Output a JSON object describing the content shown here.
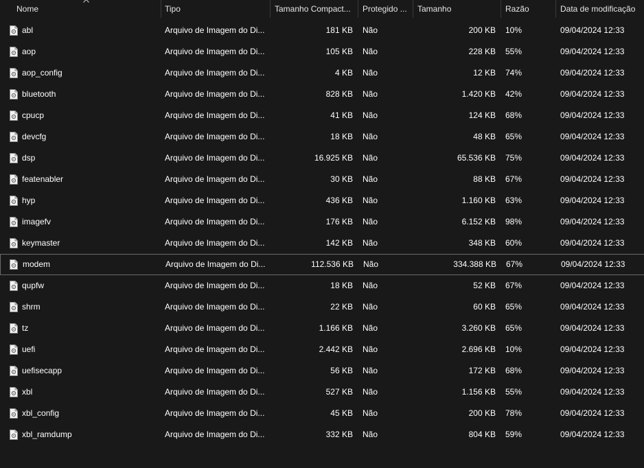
{
  "columns": {
    "name": "Nome",
    "type": "Tipo",
    "compressed_size": "Tamanho Compact...",
    "protected": "Protegido ...",
    "size": "Tamanho",
    "ratio": "Razão",
    "modified": "Data de modificação"
  },
  "icons": {
    "file": "file-image-icon",
    "sort": "sort-ascending-icon"
  },
  "colors": {
    "background": "#191919",
    "text": "#ffffff",
    "selection_border": "#6b6b6b"
  },
  "files": [
    {
      "name": "abl",
      "type": "Arquivo de Imagem do Di...",
      "compressed_size": "181 KB",
      "protected": "Não",
      "size": "200 KB",
      "ratio": "10%",
      "modified": "09/04/2024 12:33"
    },
    {
      "name": "aop",
      "type": "Arquivo de Imagem do Di...",
      "compressed_size": "105 KB",
      "protected": "Não",
      "size": "228 KB",
      "ratio": "55%",
      "modified": "09/04/2024 12:33"
    },
    {
      "name": "aop_config",
      "type": "Arquivo de Imagem do Di...",
      "compressed_size": "4 KB",
      "protected": "Não",
      "size": "12 KB",
      "ratio": "74%",
      "modified": "09/04/2024 12:33"
    },
    {
      "name": "bluetooth",
      "type": "Arquivo de Imagem do Di...",
      "compressed_size": "828 KB",
      "protected": "Não",
      "size": "1.420 KB",
      "ratio": "42%",
      "modified": "09/04/2024 12:33"
    },
    {
      "name": "cpucp",
      "type": "Arquivo de Imagem do Di...",
      "compressed_size": "41 KB",
      "protected": "Não",
      "size": "124 KB",
      "ratio": "68%",
      "modified": "09/04/2024 12:33"
    },
    {
      "name": "devcfg",
      "type": "Arquivo de Imagem do Di...",
      "compressed_size": "18 KB",
      "protected": "Não",
      "size": "48 KB",
      "ratio": "65%",
      "modified": "09/04/2024 12:33"
    },
    {
      "name": "dsp",
      "type": "Arquivo de Imagem do Di...",
      "compressed_size": "16.925 KB",
      "protected": "Não",
      "size": "65.536 KB",
      "ratio": "75%",
      "modified": "09/04/2024 12:33"
    },
    {
      "name": "featenabler",
      "type": "Arquivo de Imagem do Di...",
      "compressed_size": "30 KB",
      "protected": "Não",
      "size": "88 KB",
      "ratio": "67%",
      "modified": "09/04/2024 12:33"
    },
    {
      "name": "hyp",
      "type": "Arquivo de Imagem do Di...",
      "compressed_size": "436 KB",
      "protected": "Não",
      "size": "1.160 KB",
      "ratio": "63%",
      "modified": "09/04/2024 12:33"
    },
    {
      "name": "imagefv",
      "type": "Arquivo de Imagem do Di...",
      "compressed_size": "176 KB",
      "protected": "Não",
      "size": "6.152 KB",
      "ratio": "98%",
      "modified": "09/04/2024 12:33"
    },
    {
      "name": "keymaster",
      "type": "Arquivo de Imagem do Di...",
      "compressed_size": "142 KB",
      "protected": "Não",
      "size": "348 KB",
      "ratio": "60%",
      "modified": "09/04/2024 12:33"
    },
    {
      "name": "modem",
      "type": "Arquivo de Imagem do Di...",
      "compressed_size": "112.536 KB",
      "protected": "Não",
      "size": "334.388 KB",
      "ratio": "67%",
      "modified": "09/04/2024 12:33",
      "selected": true
    },
    {
      "name": "qupfw",
      "type": "Arquivo de Imagem do Di...",
      "compressed_size": "18 KB",
      "protected": "Não",
      "size": "52 KB",
      "ratio": "67%",
      "modified": "09/04/2024 12:33"
    },
    {
      "name": "shrm",
      "type": "Arquivo de Imagem do Di...",
      "compressed_size": "22 KB",
      "protected": "Não",
      "size": "60 KB",
      "ratio": "65%",
      "modified": "09/04/2024 12:33"
    },
    {
      "name": "tz",
      "type": "Arquivo de Imagem do Di...",
      "compressed_size": "1.166 KB",
      "protected": "Não",
      "size": "3.260 KB",
      "ratio": "65%",
      "modified": "09/04/2024 12:33"
    },
    {
      "name": "uefi",
      "type": "Arquivo de Imagem do Di...",
      "compressed_size": "2.442 KB",
      "protected": "Não",
      "size": "2.696 KB",
      "ratio": "10%",
      "modified": "09/04/2024 12:33"
    },
    {
      "name": "uefisecapp",
      "type": "Arquivo de Imagem do Di...",
      "compressed_size": "56 KB",
      "protected": "Não",
      "size": "172 KB",
      "ratio": "68%",
      "modified": "09/04/2024 12:33"
    },
    {
      "name": "xbl",
      "type": "Arquivo de Imagem do Di...",
      "compressed_size": "527 KB",
      "protected": "Não",
      "size": "1.156 KB",
      "ratio": "55%",
      "modified": "09/04/2024 12:33"
    },
    {
      "name": "xbl_config",
      "type": "Arquivo de Imagem do Di...",
      "compressed_size": "45 KB",
      "protected": "Não",
      "size": "200 KB",
      "ratio": "78%",
      "modified": "09/04/2024 12:33"
    },
    {
      "name": "xbl_ramdump",
      "type": "Arquivo de Imagem do Di...",
      "compressed_size": "332 KB",
      "protected": "Não",
      "size": "804 KB",
      "ratio": "59%",
      "modified": "09/04/2024 12:33"
    }
  ]
}
